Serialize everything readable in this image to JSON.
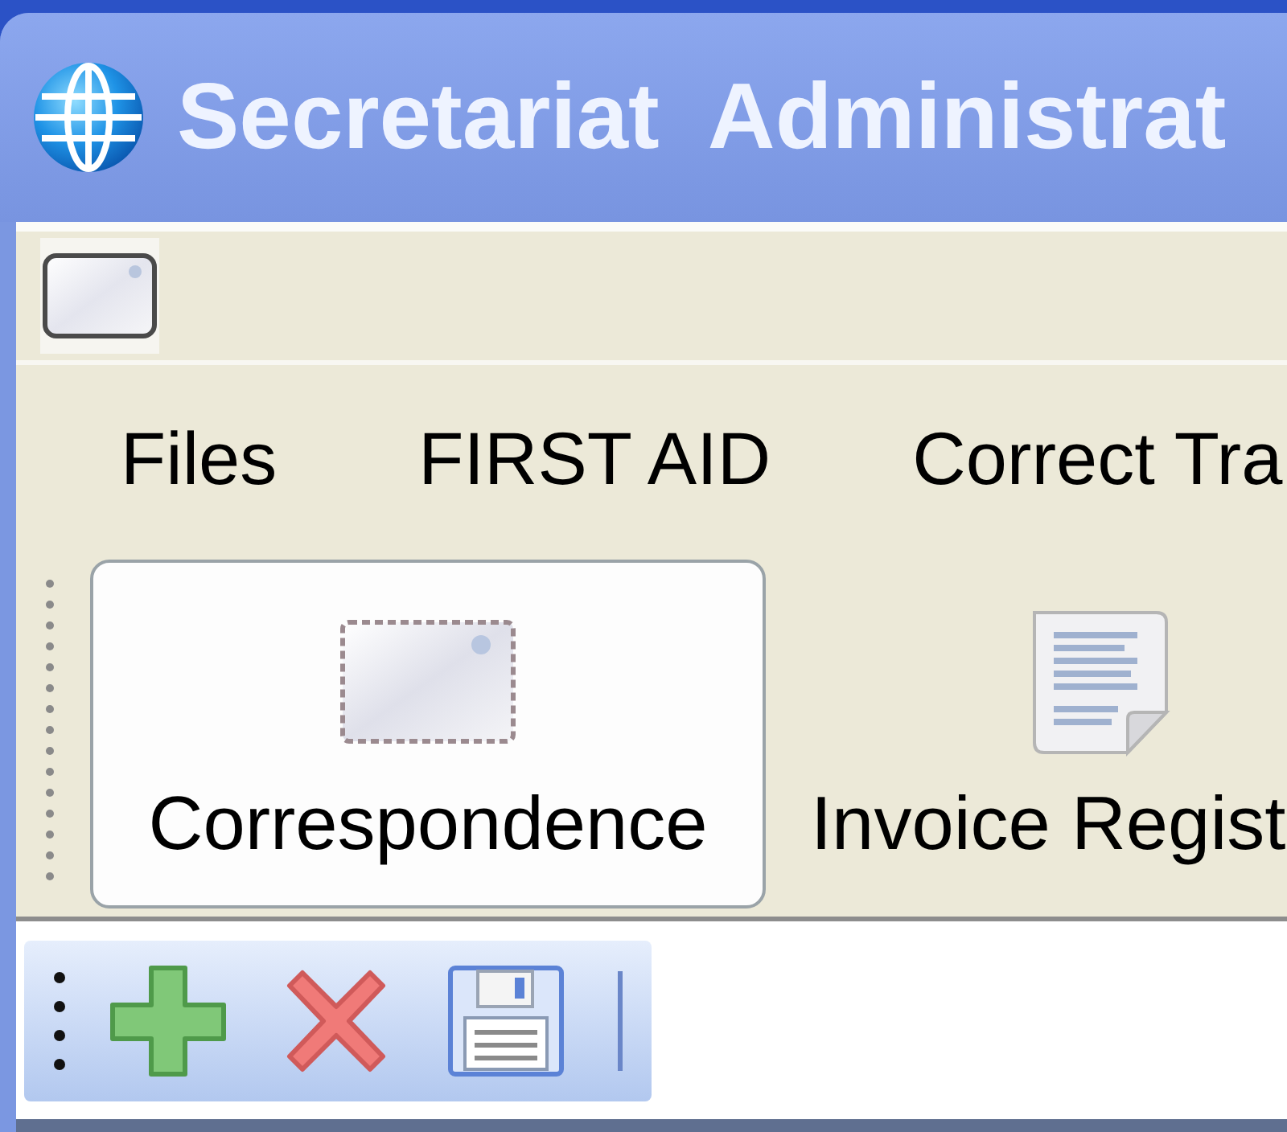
{
  "window": {
    "title": "Secretariat  Administrat"
  },
  "menu": [
    "Files",
    "FIRST AID",
    "Correct Tra"
  ],
  "modules": [
    {
      "label": "Correspondence",
      "selected": true
    },
    {
      "label": "Invoice Regist",
      "selected": false
    }
  ]
}
